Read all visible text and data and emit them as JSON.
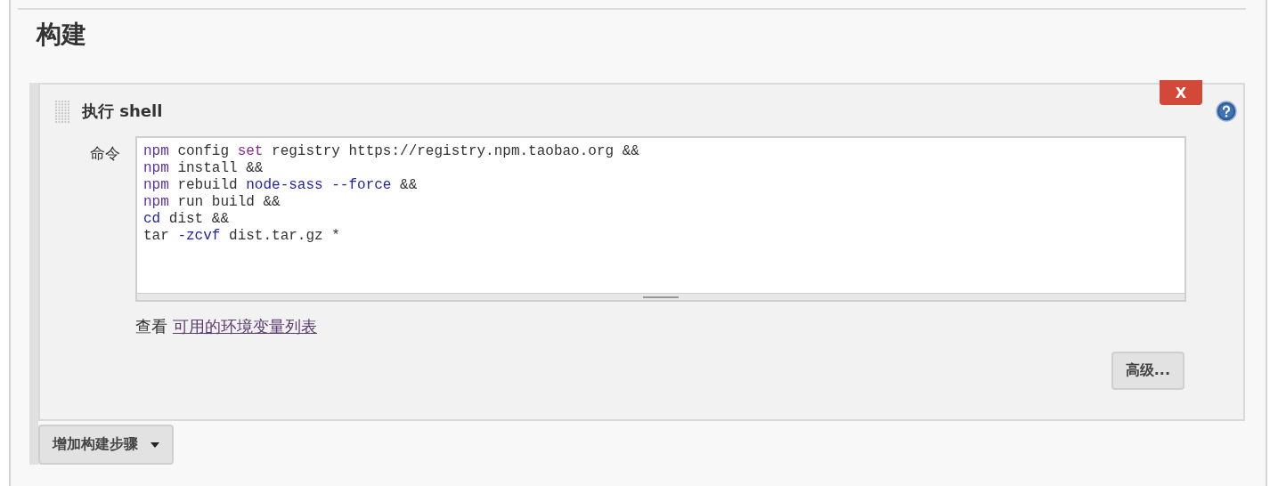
{
  "section": {
    "title": "构建"
  },
  "step": {
    "title": "执行 shell",
    "close_button": "X",
    "field_label": "命令",
    "command_lines": [
      [
        {
          "text": "npm",
          "kind": "cmd"
        },
        {
          "text": " config ",
          "kind": "plain"
        },
        {
          "text": "set",
          "kind": "builtin"
        },
        {
          "text": " registry https://registry.npm.taobao.org &&",
          "kind": "plain"
        }
      ],
      [
        {
          "text": "npm",
          "kind": "cmd"
        },
        {
          "text": " install &&",
          "kind": "plain"
        }
      ],
      [
        {
          "text": "npm",
          "kind": "cmd"
        },
        {
          "text": " rebuild ",
          "kind": "plain"
        },
        {
          "text": "node-sass --force",
          "kind": "arg"
        },
        {
          "text": " &&",
          "kind": "plain"
        }
      ],
      [
        {
          "text": "npm",
          "kind": "cmd"
        },
        {
          "text": " run build &&",
          "kind": "plain"
        }
      ],
      [
        {
          "text": "cd",
          "kind": "arg"
        },
        {
          "text": " dist &&",
          "kind": "plain"
        }
      ],
      [
        {
          "text": "tar ",
          "kind": "plain"
        },
        {
          "text": "-zcvf",
          "kind": "arg"
        },
        {
          "text": " dist.tar.gz *",
          "kind": "plain"
        }
      ]
    ],
    "hint_prefix": "查看",
    "hint_link": "可用的环境变量列表",
    "advanced_button": "高级..."
  },
  "add_step_button": "增加构建步骤"
}
